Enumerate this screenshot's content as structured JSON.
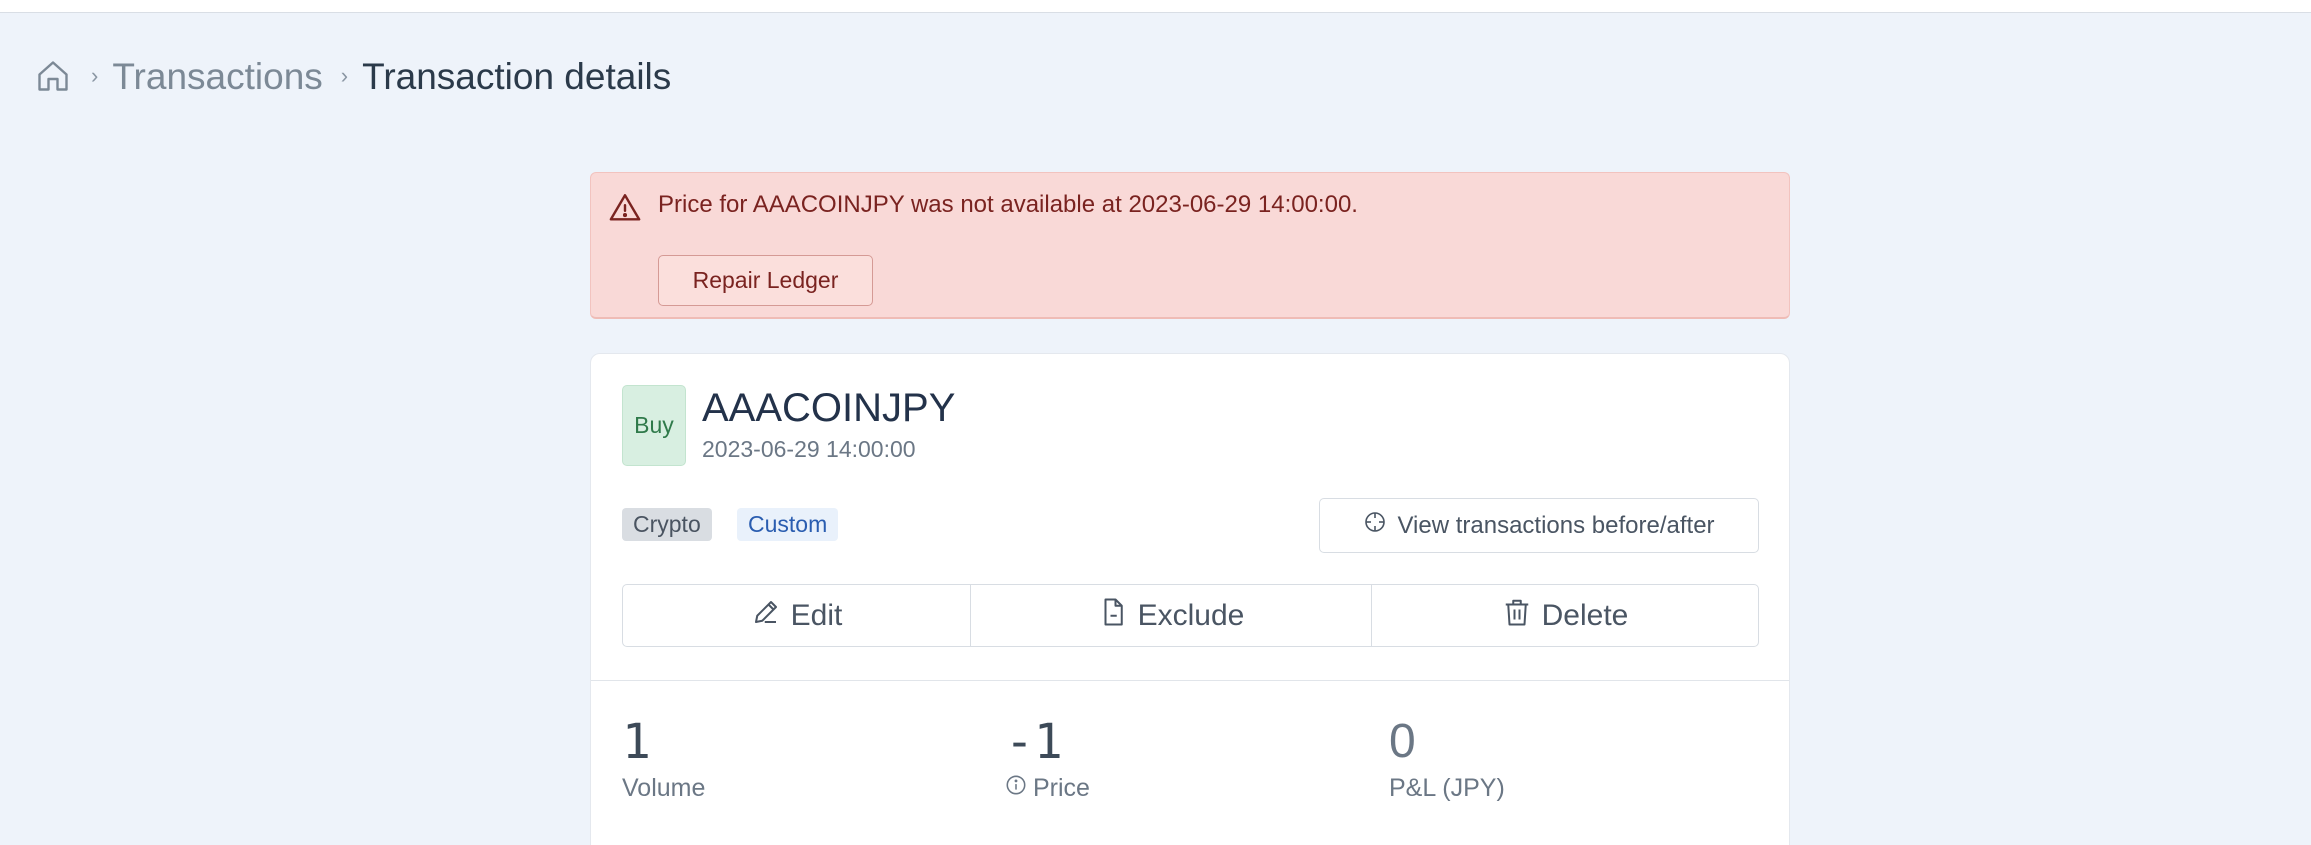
{
  "breadcrumb": {
    "home_icon": "home-icon",
    "transactions": "Transactions",
    "current": "Transaction details",
    "separator": "›"
  },
  "alert": {
    "icon": "warning-triangle-icon",
    "message": "Price for AAACOINJPY was not available at 2023-06-29 14:00:00.",
    "button_label": "Repair Ledger",
    "colors": {
      "background": "#f9d9d7",
      "text": "#7a2320"
    }
  },
  "transaction": {
    "side": "Buy",
    "symbol": "AAACOINJPY",
    "datetime": "2023-06-29 14:00:00",
    "tags": [
      "Crypto",
      "Custom"
    ],
    "view_button_label": "View transactions before/after",
    "actions": {
      "edit": "Edit",
      "exclude": "Exclude",
      "delete": "Delete"
    },
    "stats": {
      "volume": {
        "value": "1",
        "label": "Volume"
      },
      "price": {
        "value": "-1",
        "label": "Price"
      },
      "pnl": {
        "value": "0",
        "label": "P&L (JPY)"
      }
    }
  }
}
